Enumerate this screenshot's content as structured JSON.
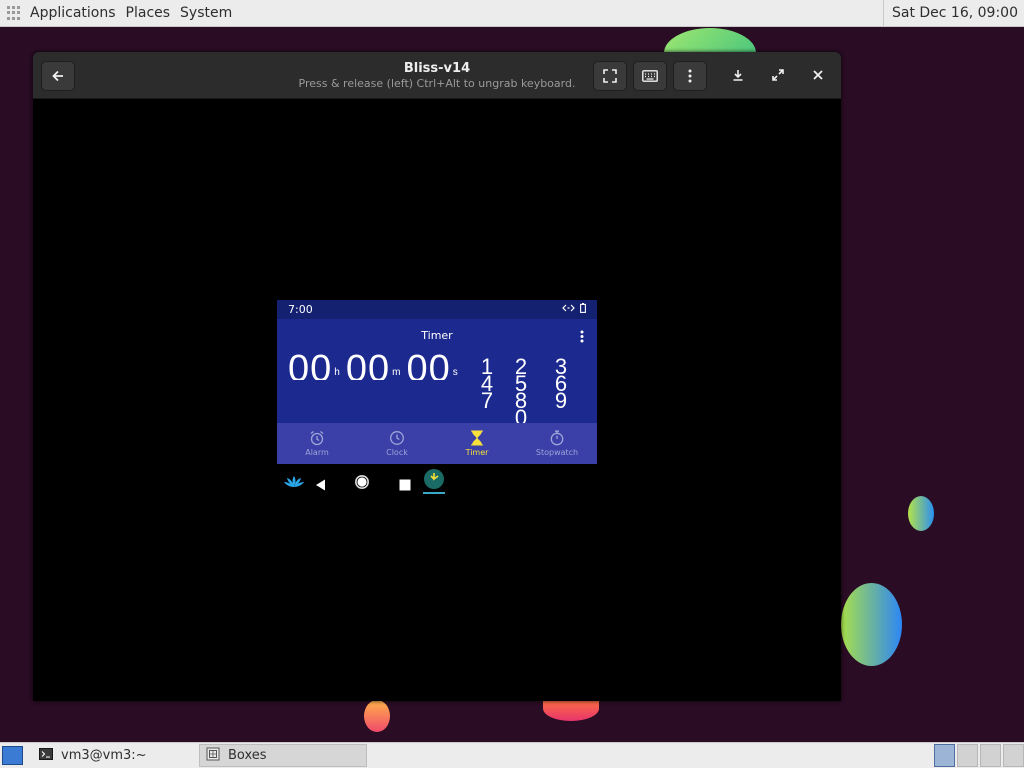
{
  "top_panel": {
    "menus": [
      "Applications",
      "Places",
      "System"
    ],
    "clock": "Sat Dec 16, 09:00"
  },
  "window": {
    "title": "Bliss-v14",
    "subtitle": "Press & release (left) Ctrl+Alt to ungrab keyboard.",
    "icons": {
      "back": "back-arrow-icon",
      "fullscreen": "fullscreen-icon",
      "keyboard": "keyboard-icon",
      "menu": "kebab-menu-icon",
      "download": "download-icon",
      "maximize": "maximize-icon",
      "close": "close-icon"
    }
  },
  "android": {
    "status_time": "7:00",
    "toolbar_title": "Timer",
    "timer": {
      "hours": "00",
      "hours_unit": "h",
      "minutes": "00",
      "minutes_unit": "m",
      "seconds": "00",
      "seconds_unit": "s"
    },
    "keypad_columns": [
      [
        "1",
        "4",
        "7"
      ],
      [
        "2",
        "5",
        "8",
        "0"
      ],
      [
        "3",
        "6",
        "9"
      ]
    ],
    "tabs": [
      {
        "label": "Alarm",
        "icon": "alarm-icon",
        "active": false
      },
      {
        "label": "Clock",
        "icon": "clock-icon",
        "active": false
      },
      {
        "label": "Timer",
        "icon": "hourglass-icon",
        "active": true
      },
      {
        "label": "Stopwatch",
        "icon": "stopwatch-icon",
        "active": false
      }
    ],
    "accent_color": "#f7e13a",
    "background_color": "#1c2a8f"
  },
  "taskbar": {
    "tasks": [
      {
        "label": "vm3@vm3:~",
        "icon": "terminal-icon"
      },
      {
        "label": "Boxes",
        "icon": "boxes-icon"
      }
    ],
    "workspace_count": 4,
    "active_workspace": 1
  }
}
